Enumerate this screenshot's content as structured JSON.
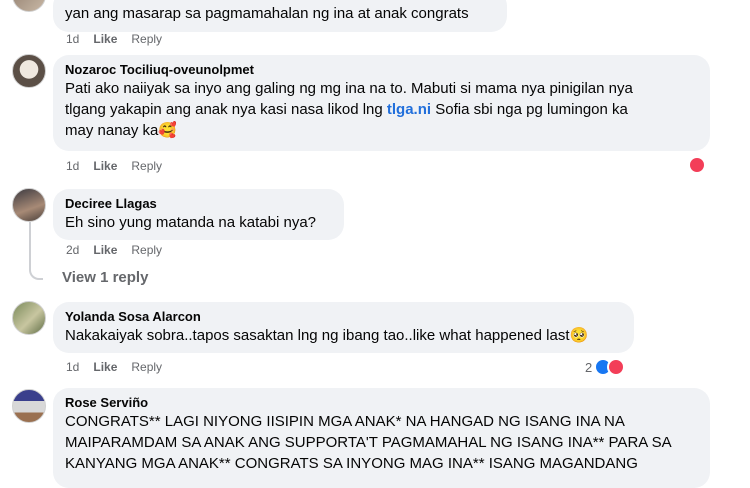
{
  "comments": [
    {
      "name": "",
      "text": "yan ang masarap sa pagmamahalan ng ina at anak congrats",
      "time": "1d",
      "like": "Like",
      "reply": "Reply"
    },
    {
      "name": "Nozaroc Tociliuq-oveunolpmet",
      "text_lines": [
        "Pati ako naiiyak sa inyo ang galing ng mg ina na to. Mabuti si mama nya pinigilan nya",
        "tlgang yakapin ang anak nya kasi nasa likod lng ",
        "tlga.ni",
        " Sofia sbi nga pg lumingon ka",
        "may nanay ka🥰"
      ],
      "time": "1d",
      "like": "Like",
      "reply": "Reply"
    },
    {
      "name": "Deciree Llagas",
      "text": "Eh sino yung matanda na katabi nya?",
      "time": "2d",
      "like": "Like",
      "reply": "Reply",
      "view_replies": "View 1 reply"
    },
    {
      "name": "Yolanda Sosa Alarcon",
      "text": "Nakakaiyak sobra..tapos sasaktan lng ng ibang tao..like what happened last🥺",
      "time": "1d",
      "like": "Like",
      "reply": "Reply",
      "reaction_count": "2"
    },
    {
      "name": "Rose Serviño",
      "text_lines": [
        "CONGRATS** LAGI NIYONG IISIPIN MGA ANAK* NA HANGAD NG ISANG INA NA",
        "MAIPARAMDAM SA ANAK ANG SUPPORTA'T PAGMAMAHAL NG ISANG INA** PARA SA",
        "KANYANG MGA ANAK** CONGRATS SA INYONG MAG INA** ISANG MAGANDANG"
      ]
    }
  ],
  "colors": {
    "bubble": "#f0f2f5",
    "meta": "#65676b",
    "link": "#216fdb",
    "love": "#f33e58",
    "like": "#1877f2"
  }
}
